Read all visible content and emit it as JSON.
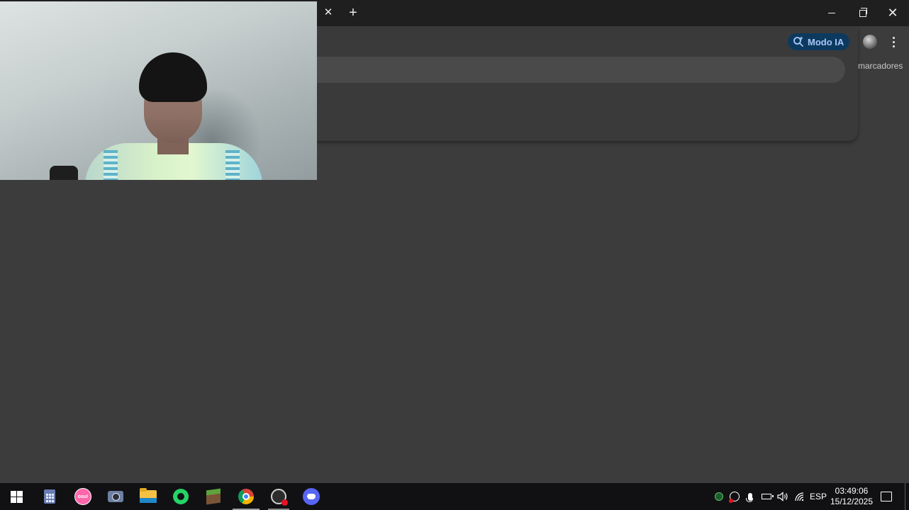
{
  "browser": {
    "tab_close_glyph": "✕",
    "new_tab_glyph": "+",
    "window_close_glyph": "✕",
    "ai_mode_label": "Modo IA",
    "bookmarks_label": "marcadores",
    "ai_mode_colors": {
      "background": "#0c3a5f",
      "text": "#a8c7fa"
    }
  },
  "webcam": {
    "icon": "webcam-feed-person"
  },
  "taskbar": {
    "apps": [
      {
        "name": "start",
        "icon": "windows-logo-icon"
      },
      {
        "name": "calculator",
        "icon": "calculator-icon"
      },
      {
        "name": "osu",
        "icon": "osu-icon",
        "label": "osu!"
      },
      {
        "name": "camera",
        "icon": "camera-icon"
      },
      {
        "name": "file-explorer",
        "icon": "folder-icon"
      },
      {
        "name": "whatsapp",
        "icon": "whatsapp-icon"
      },
      {
        "name": "minecraft",
        "icon": "minecraft-icon"
      },
      {
        "name": "chrome",
        "icon": "chrome-icon",
        "state": "active"
      },
      {
        "name": "obs",
        "icon": "obs-icon",
        "state": "running"
      },
      {
        "name": "discord",
        "icon": "discord-icon"
      }
    ],
    "tray": {
      "language": "ESP",
      "time": "03:49:06",
      "date": "15/12/2025"
    }
  }
}
